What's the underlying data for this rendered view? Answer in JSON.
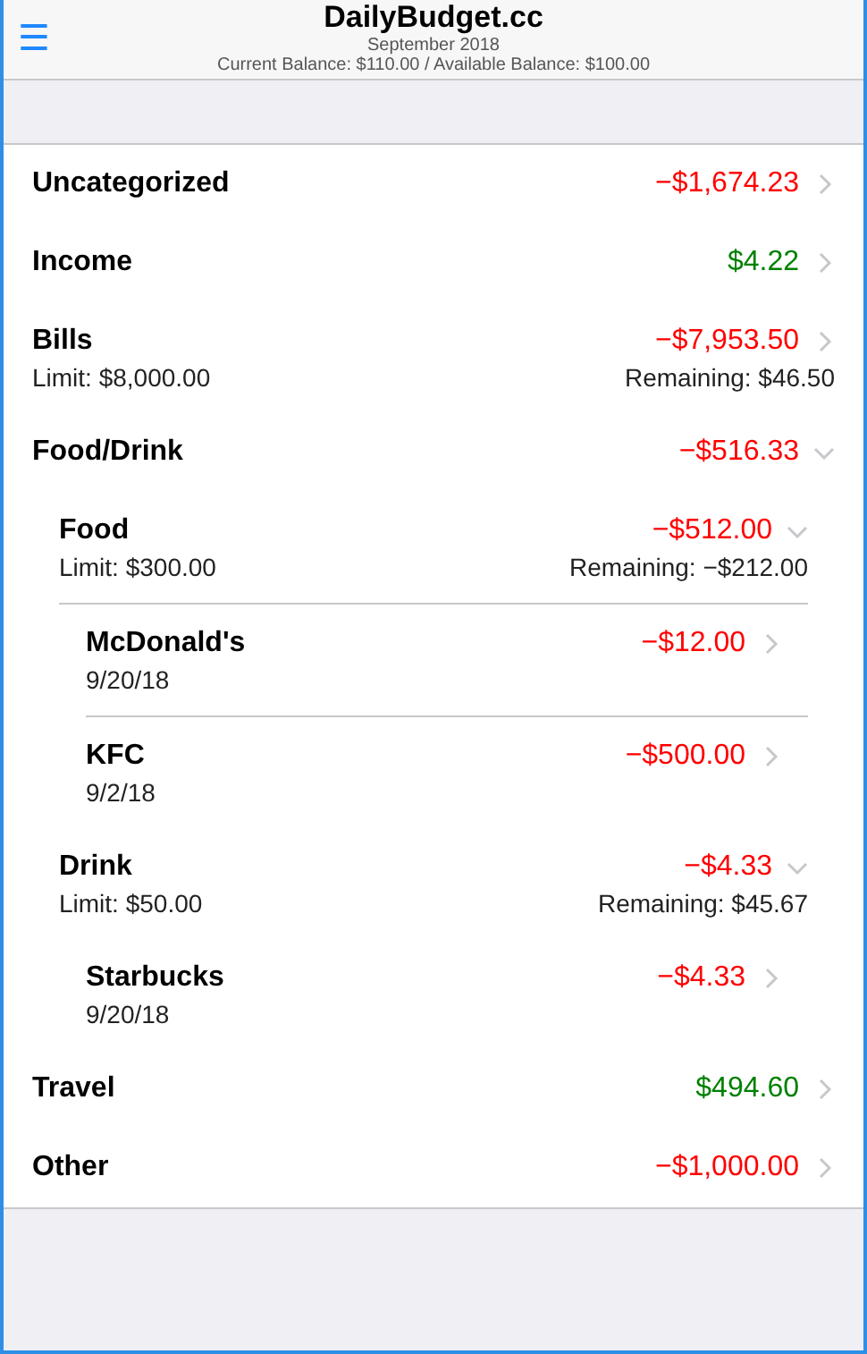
{
  "header": {
    "menu_icon": "☰",
    "title": "DailyBudget.cc",
    "subtitle": "September 2018",
    "balance": "Current Balance: $110.00 / Available Balance: $100.00"
  },
  "categories": [
    {
      "name": "Uncategorized",
      "amount": "−$1,674.23",
      "color": "#ff0000",
      "expanded": false,
      "divider_below": false
    },
    {
      "name": "Income",
      "amount": "$4.22",
      "color": "#008000",
      "expanded": false,
      "divider_below": false
    },
    {
      "name": "Bills",
      "amount": "−$7,953.50",
      "color": "#ff0000",
      "expanded": false,
      "divider_below": false,
      "limit": "Limit: $8,000.00",
      "remaining": "Remaining: $46.50"
    },
    {
      "name": "Food/Drink",
      "amount": "−$516.33",
      "color": "#ff0000",
      "expanded": true,
      "divider_below": false,
      "children": [
        {
          "name": "Food",
          "amount": "−$512.00",
          "color": "#ff0000",
          "expanded": true,
          "divider_below": true,
          "limit": "Limit: $300.00",
          "remaining": "Remaining: −$212.00",
          "children": [
            {
              "name": "McDonald's",
              "amount": "−$12.00",
              "color": "#ff0000",
              "expanded": false,
              "divider_below": true,
              "date": "9/20/18"
            },
            {
              "name": "KFC",
              "amount": "−$500.00",
              "color": "#ff0000",
              "expanded": false,
              "divider_below": false,
              "date": "9/2/18"
            }
          ]
        },
        {
          "name": "Drink",
          "amount": "−$4.33",
          "color": "#ff0000",
          "expanded": true,
          "divider_below": false,
          "limit": "Limit: $50.00",
          "remaining": "Remaining: $45.67",
          "children": [
            {
              "name": "Starbucks",
              "amount": "−$4.33",
              "color": "#ff0000",
              "expanded": false,
              "divider_below": false,
              "date": "9/20/18"
            }
          ]
        }
      ]
    },
    {
      "name": "Travel",
      "amount": "$494.60",
      "color": "#008000",
      "expanded": false,
      "divider_below": false
    },
    {
      "name": "Other",
      "amount": "−$1,000.00",
      "color": "#ff0000",
      "expanded": false,
      "divider_below": false
    }
  ]
}
